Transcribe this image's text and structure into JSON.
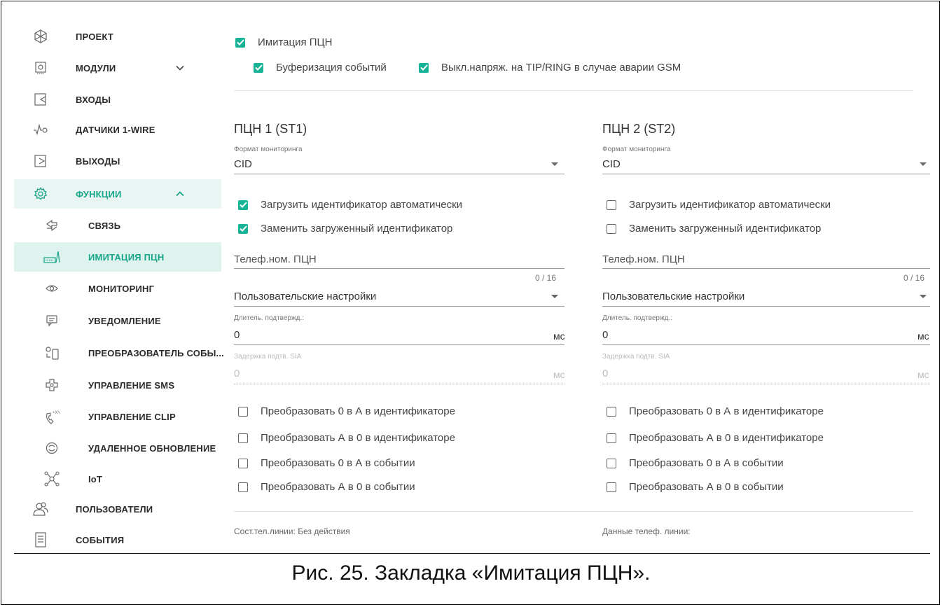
{
  "sidebar": {
    "items": [
      {
        "label": "ПРОЕКТ",
        "icon": "snowflake-icon"
      },
      {
        "label": "МОДУЛИ",
        "icon": "chip-icon"
      },
      {
        "label": "ВХОДЫ",
        "icon": "input-icon"
      },
      {
        "label": "ДАТЧИКИ 1-WIRE",
        "icon": "sensor-icon"
      },
      {
        "label": "ВЫХОДЫ",
        "icon": "output-icon"
      },
      {
        "label": "ФУНКЦИИ",
        "icon": "gear-icon"
      },
      {
        "label": "СВЯЗЬ",
        "icon": "communication-icon"
      },
      {
        "label": "ИМИТАЦИЯ ПЦН",
        "icon": "monitoring-station-icon"
      },
      {
        "label": "МОНИТОРИНГ",
        "icon": "eye-icon"
      },
      {
        "label": "УВЕДОМЛЕНИЕ",
        "icon": "message-icon"
      },
      {
        "label": "ПРЕОБРАЗОВАТЕЛЬ СОБЫ...",
        "icon": "event-converter-icon"
      },
      {
        "label": "УПРАВЛЕНИЕ SMS",
        "icon": "sms-icon"
      },
      {
        "label": "УПРАВЛЕНИЕ CLIP",
        "icon": "clip-icon"
      },
      {
        "label": "УДАЛЕННОЕ ОБНОВЛЕНИЕ",
        "icon": "refresh-icon"
      },
      {
        "label": "IoT",
        "icon": "iot-icon"
      },
      {
        "label": "ПОЛЬЗОВАТЕЛИ",
        "icon": "users-icon"
      },
      {
        "label": "СОБЫТИЯ",
        "icon": "events-icon"
      }
    ],
    "accent_color": "#17a589"
  },
  "top": {
    "emulation_label": "Имитация ПЦН",
    "emulation_checked": true,
    "buffer_label": "Буферизация событий",
    "buffer_checked": true,
    "gsm_label": "Выкл.напряж. на TIP/RING в случае аварии GSM",
    "gsm_checked": true
  },
  "station1": {
    "title": "ПЦН 1 (ST1)",
    "format_label": "Формат мониторинга",
    "format_value": "CID",
    "auto_id_label": "Загрузить идентификатор автоматически",
    "auto_id_checked": true,
    "replace_id_label": "Заменить загруженный идентификатор",
    "replace_id_checked": true,
    "phone_placeholder": "Телеф.ном. ПЦН",
    "phone_counter": "0 / 16",
    "settings_value": "Пользовательские настройки",
    "ack_label": "Длитель. подтвержд.:",
    "ack_value": "0",
    "ack_unit": "мс",
    "sia_label": "Задержка подтв. SIA",
    "sia_value": "0",
    "sia_unit": "мс",
    "conv1": "Преобразовать 0 в А в идентификаторе",
    "conv2": "Преобразовать А в 0 в идентификаторе",
    "conv3": "Преобразовать 0 в А в событии",
    "conv4": "Преобразовать А в 0 в событии",
    "status": "Сост.тел.линии: Без действия"
  },
  "station2": {
    "title": "ПЦН 2 (ST2)",
    "format_label": "Формат мониторинга",
    "format_value": "CID",
    "auto_id_label": "Загрузить идентификатор автоматически",
    "auto_id_checked": false,
    "replace_id_label": "Заменить загруженный идентификатор",
    "replace_id_checked": false,
    "phone_placeholder": "Телеф.ном. ПЦН",
    "phone_counter": "0 / 16",
    "settings_value": "Пользовательские настройки",
    "ack_label": "Длитель. подтвержд.:",
    "ack_value": "0",
    "ack_unit": "мс",
    "sia_label": "Задержка подтв. SIA",
    "sia_value": "0",
    "sia_unit": "мс",
    "conv1": "Преобразовать 0 в А в идентификаторе",
    "conv2": "Преобразовать А в 0 в идентификаторе",
    "conv3": "Преобразовать 0 в А в событии",
    "conv4": "Преобразовать А в 0 в событии",
    "status": "Данные телеф. линии:"
  },
  "caption": "Рис. 25. Закладка «Имитация ПЦН»."
}
